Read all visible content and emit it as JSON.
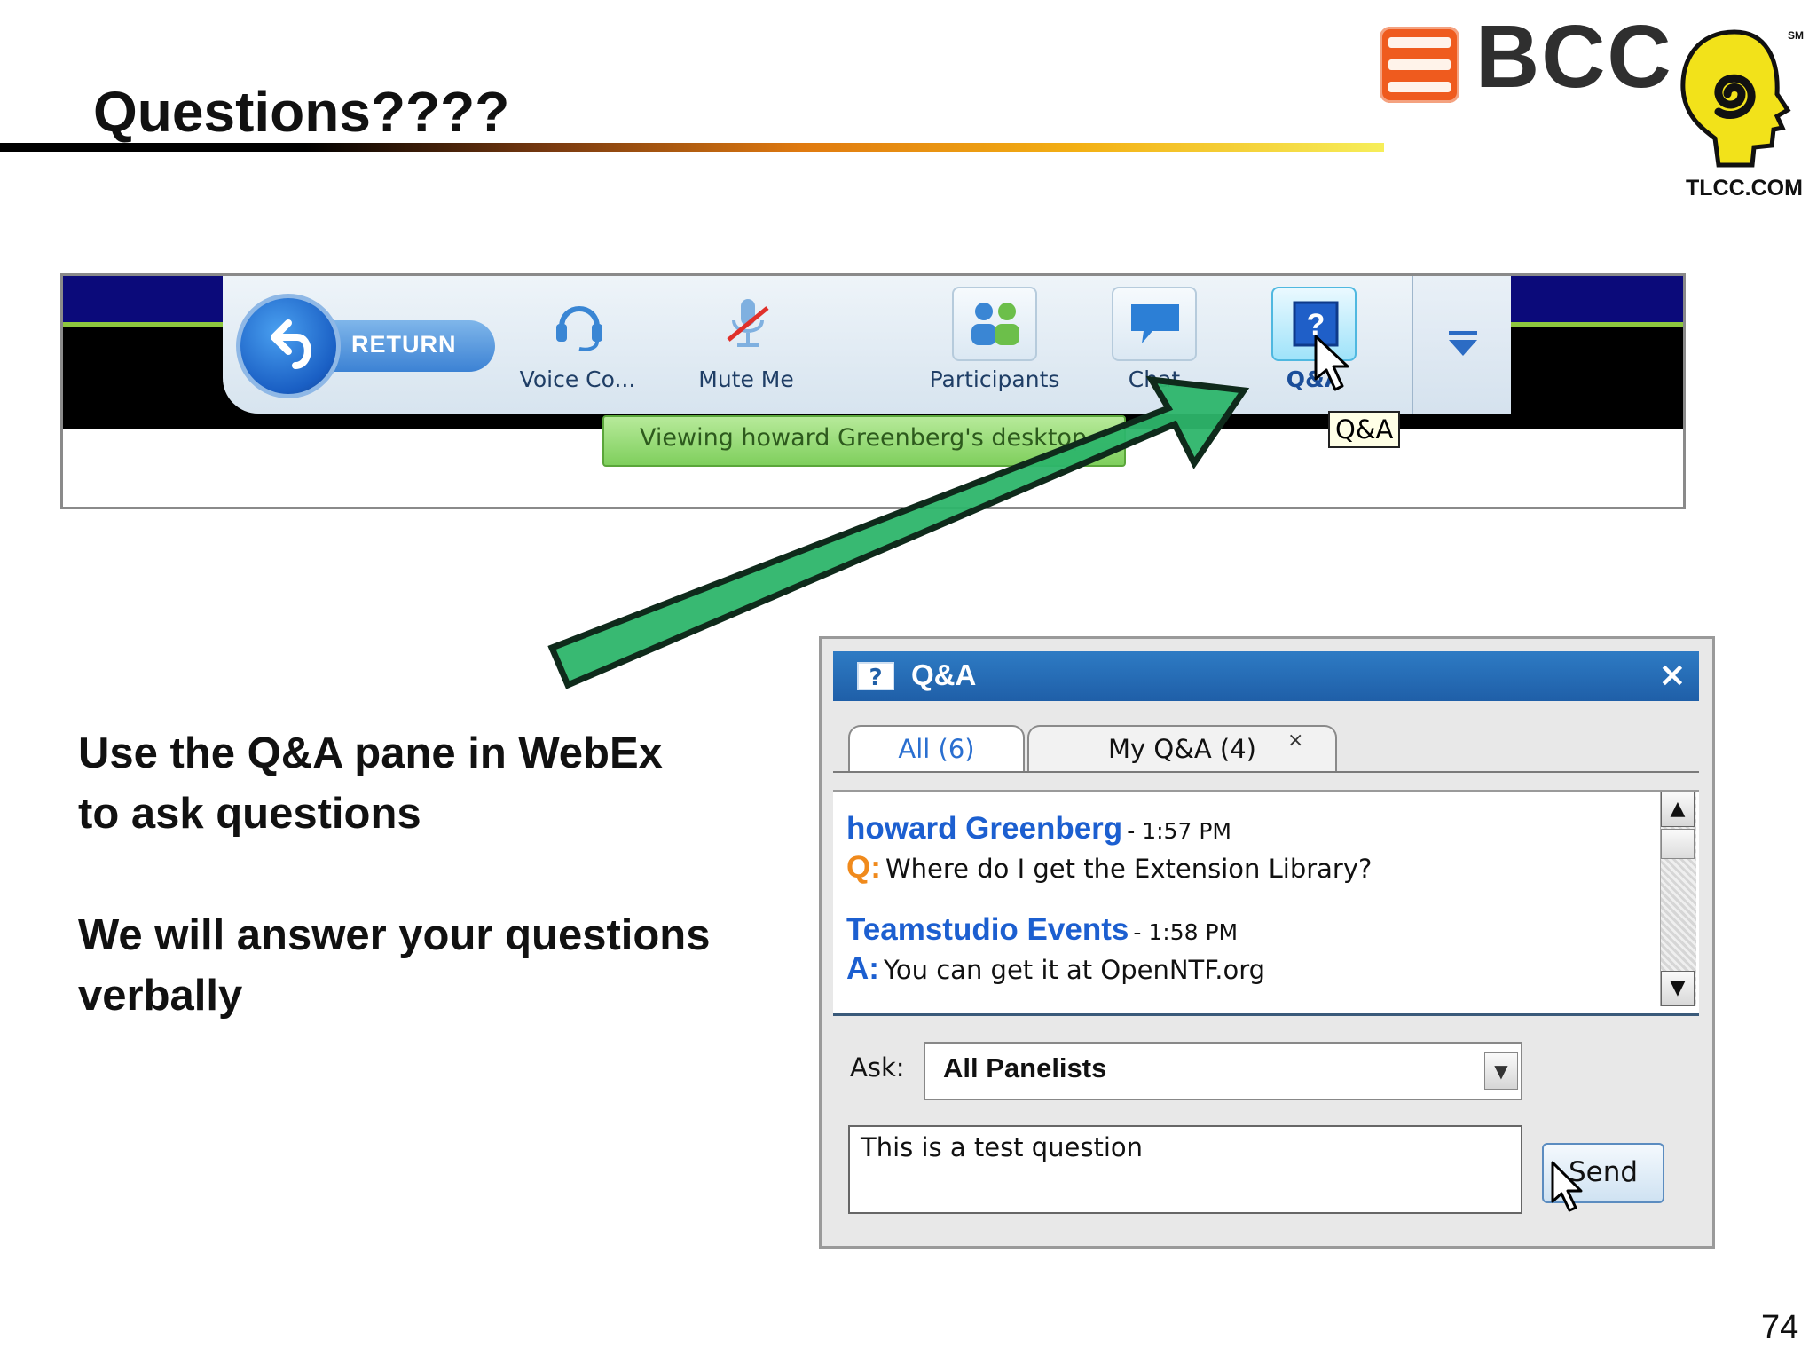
{
  "slide": {
    "title": "Questions????",
    "page_number": "74",
    "body_lines": [
      "Use the Q&A pane in WebEx",
      "to ask questions",
      "We will answer your questions",
      "verbally"
    ]
  },
  "logo": {
    "text": "BCC",
    "tagline": "TLCC.COM",
    "mark": "SM",
    "icon": "bcc-logo-icon"
  },
  "toolbar": {
    "return_label": "RETURN",
    "items": [
      {
        "label": "Voice Co...",
        "icon": "headset-icon"
      },
      {
        "label": "Mute Me",
        "icon": "microphone-muted-icon"
      },
      {
        "label": "Participants",
        "icon": "participants-icon"
      },
      {
        "label": "Chat",
        "icon": "chat-bubble-icon"
      },
      {
        "label": "Q&A",
        "icon": "question-icon"
      }
    ],
    "viewing_text": "Viewing howard Greenberg's desktop",
    "tooltip": "Q&A"
  },
  "qa_panel": {
    "title": "Q&A",
    "tabs": [
      {
        "label": "All (6)"
      },
      {
        "label": "My Q&A (4)"
      }
    ],
    "tab_close": "×",
    "close": "×",
    "entries": [
      {
        "author": "howard Greenberg",
        "time": "- 1:57 PM",
        "kind": "Q:",
        "message": "Where do I get the Extension Library?"
      },
      {
        "author": "Teamstudio Events",
        "time": "- 1:58 PM",
        "kind": "A:",
        "message": "You can get it at OpenNTF.org"
      }
    ],
    "ask_label": "Ask:",
    "ask_value": "All Panelists",
    "input_value": "This is a test question",
    "send_label": "Send"
  },
  "colors": {
    "accent_blue": "#1f5fa8",
    "question_orange": "#f08a1c",
    "answer_blue": "#1c5fd0",
    "arrow_green": "#2db56a",
    "brand_orange": "#ef5b1e"
  }
}
